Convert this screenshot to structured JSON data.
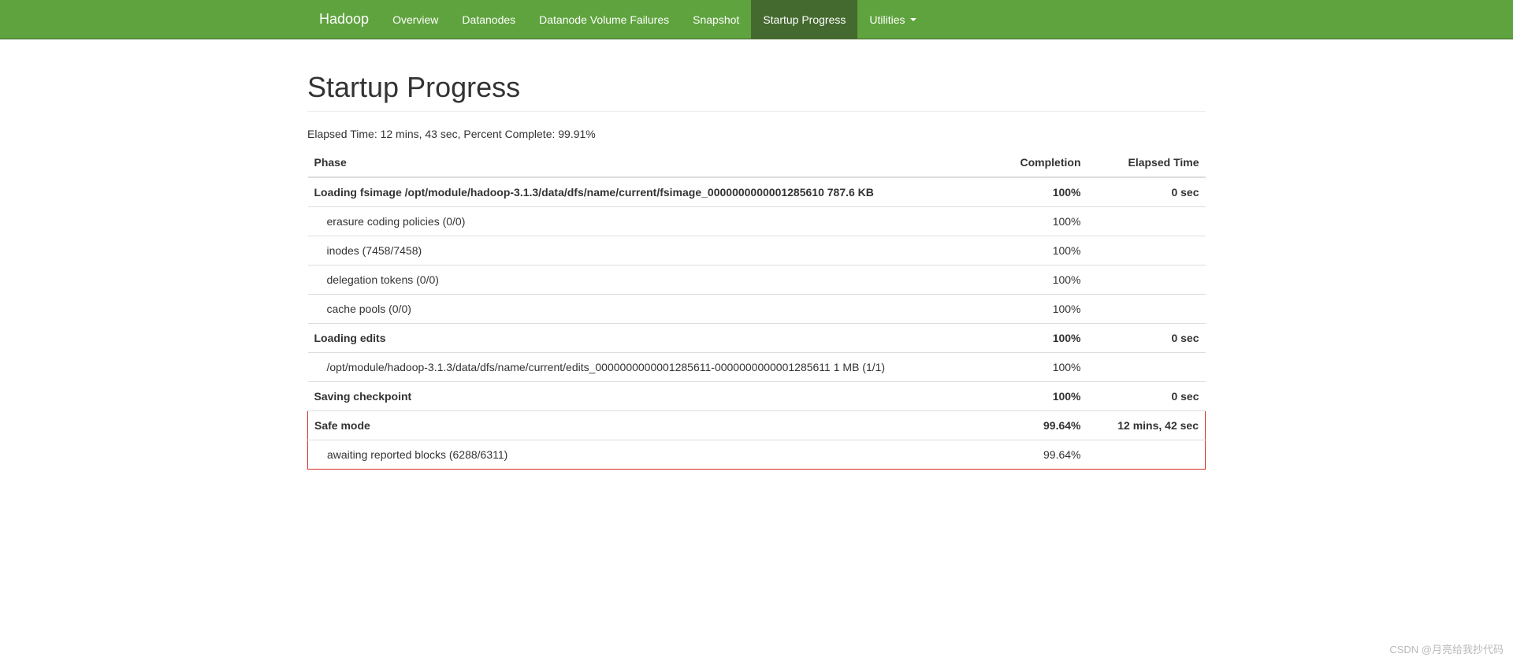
{
  "nav": {
    "brand": "Hadoop",
    "items": [
      {
        "label": "Overview",
        "active": false
      },
      {
        "label": "Datanodes",
        "active": false
      },
      {
        "label": "Datanode Volume Failures",
        "active": false
      },
      {
        "label": "Snapshot",
        "active": false
      },
      {
        "label": "Startup Progress",
        "active": true
      },
      {
        "label": "Utilities",
        "active": false,
        "dropdown": true
      }
    ]
  },
  "page": {
    "title": "Startup Progress",
    "summary": "Elapsed Time: 12 mins, 43 sec, Percent Complete: 99.91%"
  },
  "table": {
    "headers": {
      "phase": "Phase",
      "completion": "Completion",
      "elapsed": "Elapsed Time"
    },
    "rows": [
      {
        "type": "phase",
        "phase": "Loading fsimage /opt/module/hadoop-3.1.3/data/dfs/name/current/fsimage_0000000000001285610 787.6 KB",
        "completion": "100%",
        "elapsed": "0 sec",
        "highlight": false
      },
      {
        "type": "step",
        "phase": "erasure coding policies (0/0)",
        "completion": "100%",
        "elapsed": "",
        "highlight": false
      },
      {
        "type": "step",
        "phase": "inodes (7458/7458)",
        "completion": "100%",
        "elapsed": "",
        "highlight": false
      },
      {
        "type": "step",
        "phase": "delegation tokens (0/0)",
        "completion": "100%",
        "elapsed": "",
        "highlight": false
      },
      {
        "type": "step",
        "phase": "cache pools (0/0)",
        "completion": "100%",
        "elapsed": "",
        "highlight": false
      },
      {
        "type": "phase",
        "phase": "Loading edits",
        "completion": "100%",
        "elapsed": "0 sec",
        "highlight": false
      },
      {
        "type": "step",
        "phase": "/opt/module/hadoop-3.1.3/data/dfs/name/current/edits_0000000000001285611-0000000000001285611 1 MB (1/1)",
        "completion": "100%",
        "elapsed": "",
        "highlight": false
      },
      {
        "type": "phase",
        "phase": "Saving checkpoint",
        "completion": "100%",
        "elapsed": "0 sec",
        "highlight": false
      },
      {
        "type": "phase",
        "phase": "Safe mode",
        "completion": "99.64%",
        "elapsed": "12 mins, 42 sec",
        "highlight": true
      },
      {
        "type": "step",
        "phase": "awaiting reported blocks (6288/6311)",
        "completion": "99.64%",
        "elapsed": "",
        "highlight": true
      }
    ]
  },
  "watermark": "CSDN @月亮给我抄代码"
}
